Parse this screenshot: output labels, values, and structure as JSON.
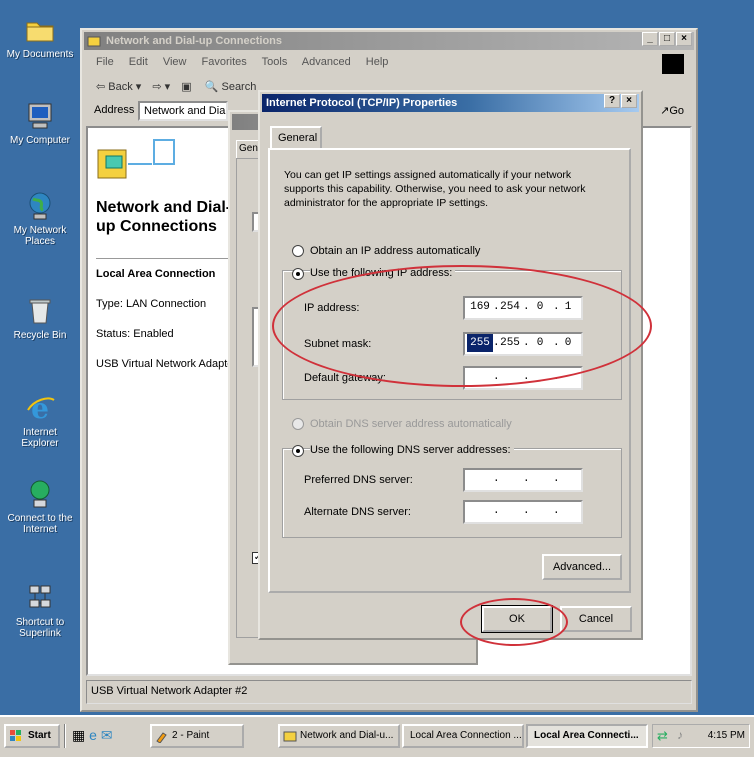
{
  "desktop": {
    "icons": [
      {
        "name": "my-documents",
        "label": "My Documents",
        "icon": "folder-icon"
      },
      {
        "name": "my-computer",
        "label": "My Computer",
        "icon": "computer-icon"
      },
      {
        "name": "my-network-places",
        "label": "My Network Places",
        "icon": "network-globe-icon"
      },
      {
        "name": "recycle-bin",
        "label": "Recycle Bin",
        "icon": "recycle-bin-icon"
      },
      {
        "name": "internet-explorer",
        "label": "Internet Explorer",
        "icon": "internet-explorer-icon"
      },
      {
        "name": "connect-to-internet",
        "label": "Connect to the Internet",
        "icon": "connect-icon"
      },
      {
        "name": "shortcut-superlink",
        "label": "Shortcut to Superlink",
        "icon": "shortcut-icon"
      }
    ]
  },
  "explorer": {
    "title": "Network and Dial-up Connections",
    "menu": [
      "File",
      "Edit",
      "View",
      "Favorites",
      "Tools",
      "Advanced",
      "Help"
    ],
    "toolbar": {
      "back": "Back",
      "search": "Search"
    },
    "address_label": "Address",
    "address_value": "Network and Dial-up Connections",
    "go_label": "Go",
    "heading": "Network and Dial-up Connections",
    "item_title": "Local Area Connection",
    "item_type": "Type: LAN Connection",
    "item_status": "Status: Enabled",
    "item_adapter": "USB Virtual Network Adapter",
    "statusbar": "USB Virtual Network Adapter #2"
  },
  "lac_props": {
    "tab": "General"
  },
  "tcpip": {
    "title": "Internet Protocol (TCP/IP) Properties",
    "help_btn": "?",
    "close_btn": "×",
    "tab": "General",
    "intro": "You can get IP settings assigned automatically if your network supports this capability. Otherwise, you need to ask your network administrator for the appropriate IP settings.",
    "radio_auto_ip": "Obtain an IP address automatically",
    "radio_manual_ip": "Use the following IP address:",
    "ip_label": "IP address:",
    "ip_octets": [
      "169",
      "254",
      "0",
      "1"
    ],
    "mask_label": "Subnet mask:",
    "mask_octets": [
      "255",
      "255",
      "0",
      "0"
    ],
    "gateway_label": "Default gateway:",
    "gateway_octets": [
      "",
      "",
      "",
      ""
    ],
    "radio_auto_dns": "Obtain DNS server address automatically",
    "radio_manual_dns": "Use the following DNS server addresses:",
    "preferred_dns_label": "Preferred DNS server:",
    "alternate_dns_label": "Alternate DNS server:",
    "advanced_btn": "Advanced...",
    "ok_btn": "OK",
    "cancel_btn": "Cancel"
  },
  "taskbar": {
    "start": "Start",
    "buttons": [
      {
        "label": "2 - Paint",
        "icon": "paint-icon"
      },
      {
        "label": "Network and Dial-u...",
        "icon": "network-folder-icon"
      },
      {
        "label": "Local Area Connection ...",
        "icon": "network-icon"
      },
      {
        "label": "Local Area Connecti...",
        "icon": "network-icon"
      }
    ],
    "clock": "4:15 PM"
  },
  "colors": {
    "desktop": "#3a6ea5",
    "title_active": "#0a246a",
    "annotation": "#d0313a"
  }
}
